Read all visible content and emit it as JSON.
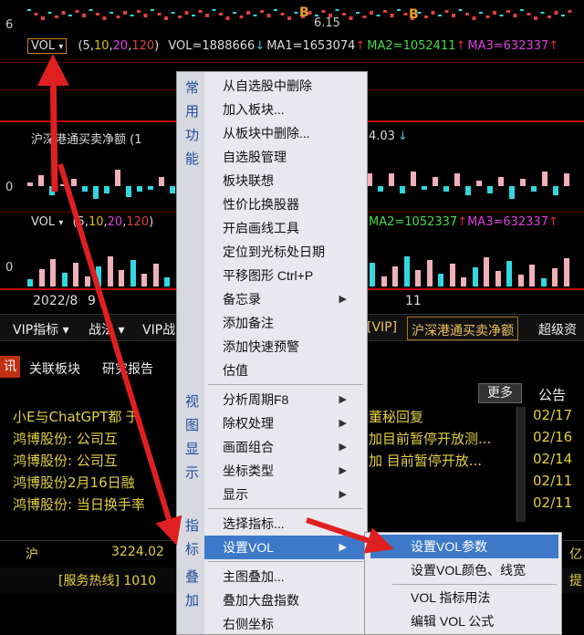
{
  "top_chart": {
    "price_label": "6.15",
    "axis_top": "6",
    "b_marker": "B"
  },
  "vol_indicator": {
    "name": "VOL",
    "dropdown_glyph": "▾",
    "params_open": "(",
    "p1": "5",
    "p2": "10",
    "p3": "20",
    "p4": "120",
    "params_close": ")",
    "vol_text": "VOL=1888666",
    "ma1_text": "MA1=1653074",
    "ma2_text": "MA2=1052411",
    "ma3_text": "MA3=632337"
  },
  "flow_indicator": {
    "name": "沪深港通买卖净额",
    "suffix": "(1",
    "value_text": "4.03"
  },
  "vol_indicator_2": {
    "name": "VOL",
    "dropdown_glyph": "▾",
    "params_open": "(",
    "p1": "5",
    "p2": "10",
    "p3": "20",
    "p4": "120",
    "params_close": ")",
    "ma2_text": "MA2=1052337",
    "ma3_text": "MA3=632337"
  },
  "axis": {
    "zero1": "0",
    "zero2": "0",
    "date_label": "2022/8",
    "date_9": "9",
    "date_11": "11"
  },
  "tabs": {
    "vip_indicator": "VIP指标 ▾",
    "strategy": "战法 ▾",
    "vip_battle": "VIP战",
    "vip_tag": "[VIP]",
    "flow_tab": "沪深港通买卖净额",
    "super_fund": "超级资"
  },
  "info_tabs": {
    "xun": "讯",
    "related_sector": "关联板块",
    "research": "研究报告",
    "more": "更多",
    "notice": "公告"
  },
  "news": [
    {
      "left": "小E与ChatGPT都",
      "mid": "于",
      "right": "董秘回复",
      "date": "02/17"
    },
    {
      "left": "鸿博股份: 公司互",
      "mid": "",
      "right": "加目前暂停开放测...",
      "date": "02/16"
    },
    {
      "left": "鸿博股份: 公司互",
      "mid": "",
      "right": "加 目前暂停开放...",
      "date": "02/14"
    },
    {
      "left": "鸿博股份2月16日融",
      "mid": "",
      "right": "",
      "date": "02/11"
    },
    {
      "left": "鸿博股份: 当日换手率",
      "mid": "",
      "right": "",
      "date": "02/11"
    }
  ],
  "index_bar": {
    "market": "沪",
    "value": "3224.02",
    "right_text": "亿"
  },
  "hotline": {
    "text": "[服务热线] 1010",
    "right_text": "提"
  },
  "context_menu": {
    "side_groups": [
      {
        "chars": [
          "常",
          "用",
          "功",
          "能"
        ]
      },
      {
        "chars": [
          "视",
          "图",
          "显",
          "示"
        ]
      },
      {
        "chars": [
          "指",
          "标"
        ]
      },
      {
        "chars": [
          "叠",
          "加"
        ]
      }
    ],
    "items": [
      {
        "label": "从自选股中删除",
        "submenu": false
      },
      {
        "label": "加入板块...",
        "submenu": false
      },
      {
        "label": "从板块中删除...",
        "submenu": false
      },
      {
        "label": "自选股管理",
        "submenu": false
      },
      {
        "label": "板块联想",
        "submenu": false
      },
      {
        "label": "性价比换股器",
        "submenu": false
      },
      {
        "label": "开启画线工具",
        "submenu": false
      },
      {
        "label": "定位到光标处日期",
        "submenu": false
      },
      {
        "label": "平移图形  Ctrl+P",
        "submenu": false
      },
      {
        "label": "备忘录",
        "submenu": true
      },
      {
        "label": "添加备注",
        "submenu": false
      },
      {
        "label": "添加快速预警",
        "submenu": false
      },
      {
        "label": "估值",
        "submenu": false
      },
      {
        "label": "分析周期F8",
        "submenu": true
      },
      {
        "label": "除权处理",
        "submenu": true
      },
      {
        "label": "画面组合",
        "submenu": true
      },
      {
        "label": "坐标类型",
        "submenu": true
      },
      {
        "label": "显示",
        "submenu": true
      },
      {
        "label": "选择指标...",
        "submenu": false
      },
      {
        "label": "设置VOL",
        "submenu": true
      },
      {
        "label": "主图叠加...",
        "submenu": false
      },
      {
        "label": "叠加大盘指数",
        "submenu": false
      },
      {
        "label": "右侧坐标",
        "submenu": false
      }
    ],
    "submenu_glyph": "▶"
  },
  "vol_submenu": {
    "items": [
      {
        "label": "设置VOL参数"
      },
      {
        "label": "设置VOL颜色、线宽"
      },
      {
        "label": "VOL 指标用法"
      },
      {
        "label": "编辑 VOL 公式"
      }
    ]
  },
  "colors": {
    "menu_bg": "#e8e8ee",
    "highlight": "#3d79c8",
    "annotation_arrow": "#e02020",
    "news_text": "#e0d040"
  }
}
